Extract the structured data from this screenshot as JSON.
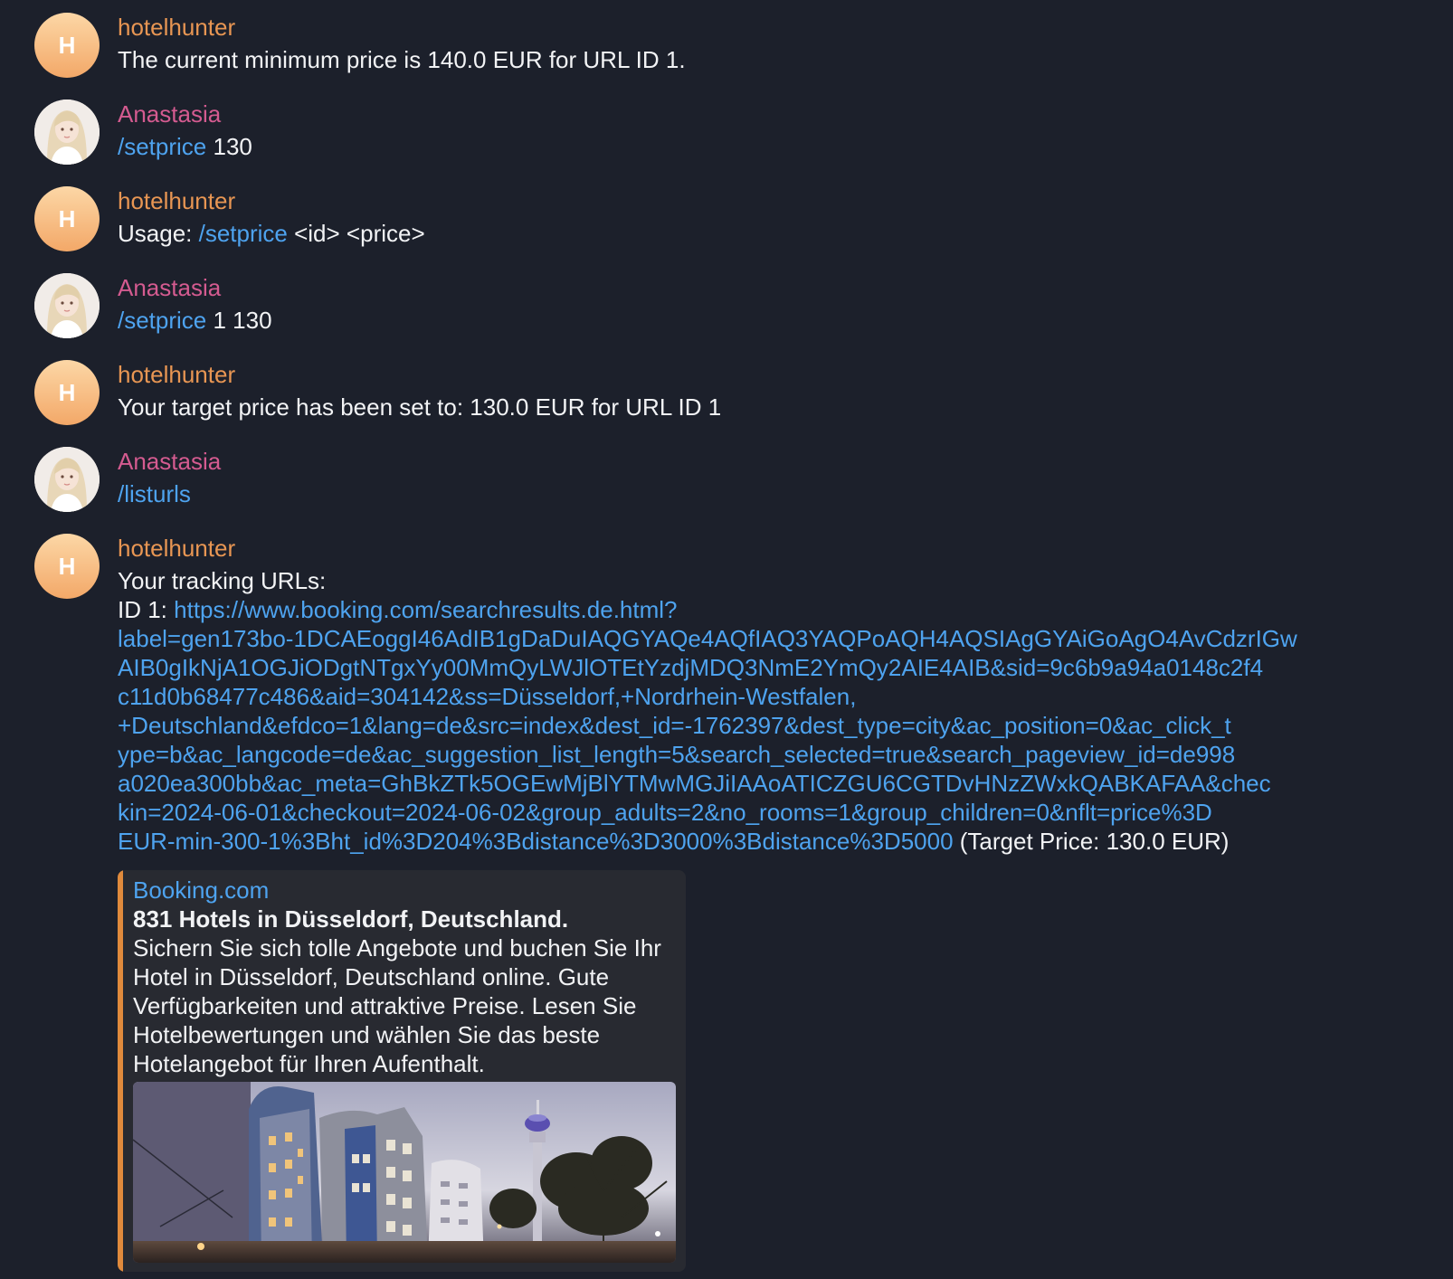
{
  "messages": [
    {
      "sender": "hotelhunter",
      "avatar_letter": "H",
      "text": "The current minimum price is 140.0 EUR for URL ID 1."
    },
    {
      "sender": "Anastasia",
      "command": "/setprice",
      "args": " 130"
    },
    {
      "sender": "hotelhunter",
      "avatar_letter": "H",
      "prefix": "Usage: ",
      "command": "/setprice",
      "suffix": " <id> <price>"
    },
    {
      "sender": "Anastasia",
      "command": "/setprice",
      "args": " 1 130"
    },
    {
      "sender": "hotelhunter",
      "avatar_letter": "H",
      "text": "Your target price has been set to: 130.0 EUR for URL ID 1"
    },
    {
      "sender": "Anastasia",
      "command": "/listurls"
    },
    {
      "sender": "hotelhunter",
      "avatar_letter": "H",
      "heading": "Your tracking URLs:",
      "id_label": "ID 1: ",
      "lines": [
        "https://www.booking.com/searchresults.de.html?",
        "label=gen173bo-1DCAEoggI46AdIB1gDaDuIAQGYAQe4AQfIAQ3YAQPoAQH4AQSIAgGYAiGoAgO4AvCdzrIGw",
        "AIB0gIkNjA1OGJiODgtNTgxYy00MmQyLWJlOTEtYzdjMDQ3NmE2YmQy2AIE4AIB&sid=9c6b9a94a0148c2f4",
        "c11d0b68477c486&aid=304142&ss=Düsseldorf,+Nordrhein-Westfalen,",
        "+Deutschland&efdco=1&lang=de&src=index&dest_id=-1762397&dest_type=city&ac_position=0&ac_click_t",
        "ype=b&ac_langcode=de&ac_suggestion_list_length=5&search_selected=true&search_pageview_id=de998",
        "a020ea300bb&ac_meta=GhBkZTk5OGEwMjBlYTMwMGJiIAAoATICZGU6CGTDvHNzZWxkQABKAFAA&chec",
        "kin=2024-06-01&checkout=2024-06-02&group_adults=2&no_rooms=1&group_children=0&nflt=price%3D",
        "EUR-min-300-1%3Bht_id%3D204%3Bdistance%3D3000%3Bdistance%3D5000"
      ],
      "target_price": " (Target Price: 130.0 EUR)"
    }
  ],
  "preview": {
    "site": "Booking.com",
    "title": "831 Hotels in Düsseldorf, Deutschland.",
    "description": "Sichern Sie sich tolle Angebote und buchen Sie Ihr Hotel in Düsseldorf, Deutschland online. Gute Verfügbarkeiten und attraktive Preise. Lesen Sie Hotelbewertungen und wählen Sie das beste Hotelangebot für Ihren Aufenthalt.",
    "image": "photo of Düsseldorf Medienhafen buildings and Rheinturm at night"
  },
  "colors": {
    "background": "#1c202b",
    "bot_name": "#e89653",
    "user_name": "#d45b90",
    "link": "#4ea3ef",
    "preview_bar": "#e08a3c"
  }
}
